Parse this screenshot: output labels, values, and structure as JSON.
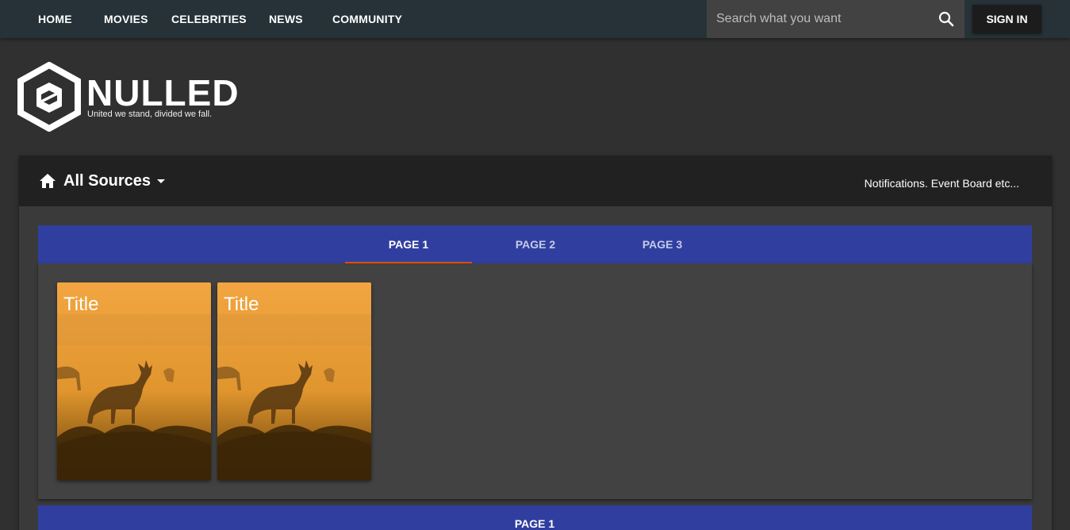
{
  "nav": {
    "items": [
      {
        "label": "HOME"
      },
      {
        "label": "MOVIES"
      },
      {
        "label": "CELEBRITIES"
      },
      {
        "label": "NEWS"
      },
      {
        "label": "COMMUNITY"
      }
    ],
    "search_placeholder": "Search what you want",
    "sign_in_label": "SIGN IN"
  },
  "logo": {
    "name": "NULLED",
    "tagline": "United we stand, divided we fall."
  },
  "panel": {
    "source_label": "All Sources",
    "notifications_text": "Notifications. Event Board etc...",
    "tabs": [
      {
        "label": "PAGE 1",
        "active": true
      },
      {
        "label": "PAGE 2",
        "active": false
      },
      {
        "label": "PAGE 3",
        "active": false
      }
    ],
    "cards": [
      {
        "title": "Title"
      },
      {
        "title": "Title"
      }
    ],
    "bottom_tab_label": "PAGE 1"
  },
  "colors": {
    "nav_bg": "#263238",
    "tab_bar": "#303f9f",
    "tab_indicator": "#e65100"
  }
}
